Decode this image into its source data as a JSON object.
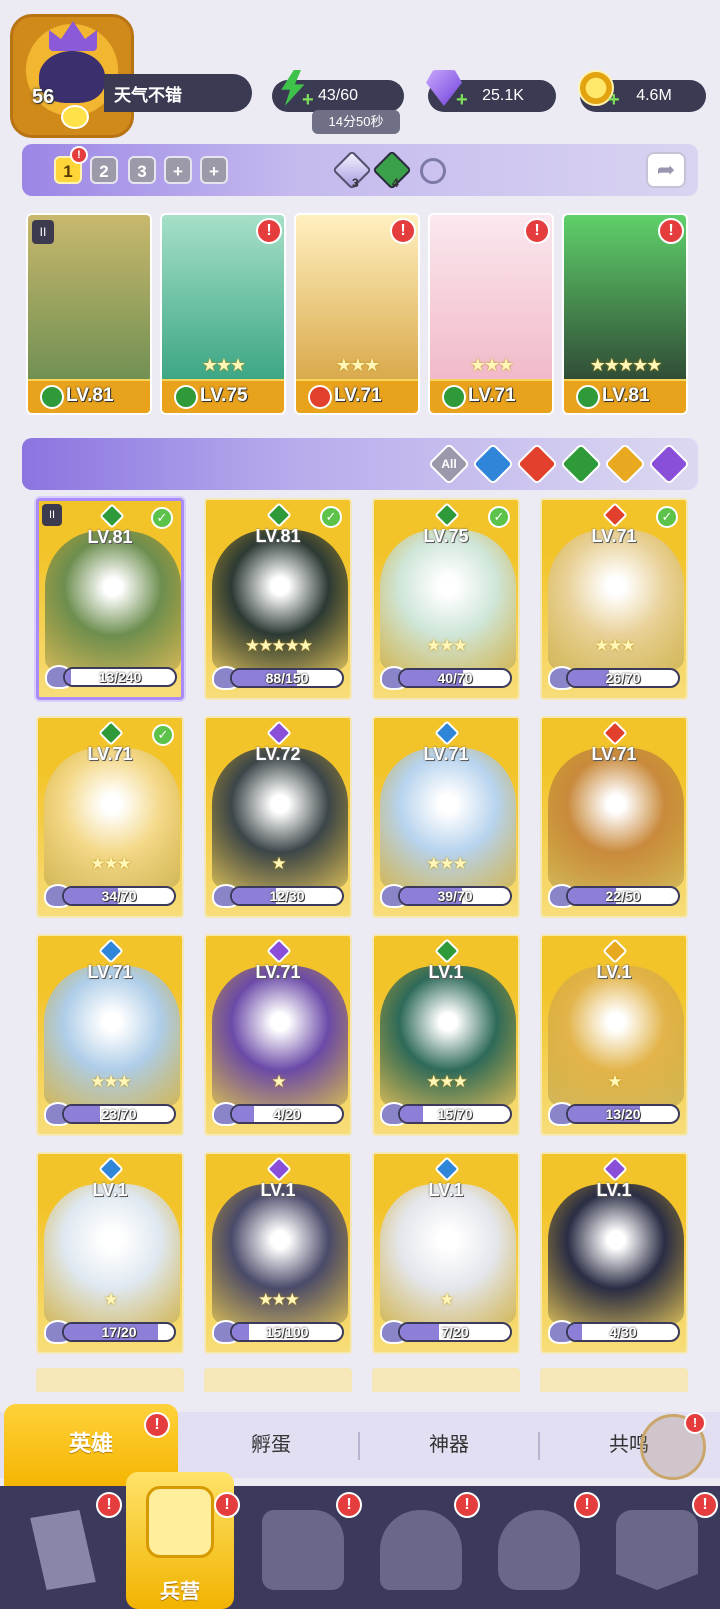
{
  "player": {
    "level": "56",
    "name": "天气不错"
  },
  "resources": {
    "energy": "43/60",
    "energy_timer": "14分50秒",
    "gems": "25.1K",
    "gold": "4.6M"
  },
  "team_bar": {
    "slots": [
      "1",
      "2",
      "3",
      "+",
      "+"
    ],
    "item_counts": [
      "3",
      "4"
    ]
  },
  "team": [
    {
      "level": "LV.81",
      "element_color": "#2f9a3a",
      "art": [
        "#6f8f52",
        "#c9b86d"
      ],
      "stars": "",
      "alert": false
    },
    {
      "level": "LV.75",
      "element_color": "#2f9a3a",
      "art": [
        "#3aa583",
        "#a6e0c8"
      ],
      "stars": "★★★",
      "alert": true
    },
    {
      "level": "LV.71",
      "element_color": "#e0402c",
      "art": [
        "#d9a84a",
        "#fff0c0"
      ],
      "stars": "★★★",
      "alert": true
    },
    {
      "level": "LV.71",
      "element_color": "#2f9a3a",
      "art": [
        "#f1b8c8",
        "#fbe8ee"
      ],
      "stars": "★★★",
      "alert": true
    },
    {
      "level": "LV.81",
      "element_color": "#2f9a3a",
      "art": [
        "#2f4a35",
        "#5fd06a"
      ],
      "stars": "★★★★★",
      "alert": true
    }
  ],
  "filters": [
    {
      "label": "All",
      "color": "#9a98aa"
    },
    {
      "label": "",
      "color": "#2f86d8"
    },
    {
      "label": "",
      "color": "#e0402c"
    },
    {
      "label": "",
      "color": "#2f9a3a"
    },
    {
      "label": "",
      "color": "#e8a920"
    },
    {
      "label": "",
      "color": "#8a4fd8"
    }
  ],
  "heroes": [
    {
      "level": "LV.81",
      "progress": "13/240",
      "ratio": 0.054,
      "elem": "#2f9a3a",
      "check": true,
      "stars": "",
      "art": "#6d8e4f"
    },
    {
      "level": "LV.81",
      "progress": "88/150",
      "ratio": 0.587,
      "elem": "#2f9a3a",
      "check": true,
      "stars": "★★★★★",
      "art": "#2c3a34"
    },
    {
      "level": "LV.75",
      "progress": "40/70",
      "ratio": 0.571,
      "elem": "#2f9a3a",
      "check": true,
      "stars": "★★★",
      "art": "#cfe6d9"
    },
    {
      "level": "LV.71",
      "progress": "26/70",
      "ratio": 0.371,
      "elem": "#e0402c",
      "check": true,
      "stars": "★★★",
      "art": "#e9d29a"
    },
    {
      "level": "LV.71",
      "progress": "34/70",
      "ratio": 0.486,
      "elem": "#2f9a3a",
      "check": true,
      "stars": "★★★",
      "art": "#f4d98a"
    },
    {
      "level": "LV.72",
      "progress": "12/30",
      "ratio": 0.4,
      "elem": "#8a4fd8",
      "check": false,
      "stars": "★",
      "art": "#3c4649"
    },
    {
      "level": "LV.71",
      "progress": "39/70",
      "ratio": 0.557,
      "elem": "#2f86d8",
      "check": false,
      "stars": "★★★",
      "art": "#b7d3ee"
    },
    {
      "level": "LV.71",
      "progress": "22/50",
      "ratio": 0.44,
      "elem": "#e0402c",
      "check": false,
      "stars": "",
      "art": "#c98a3c"
    },
    {
      "level": "LV.71",
      "progress": "23/70",
      "ratio": 0.329,
      "elem": "#2f86d8",
      "check": false,
      "stars": "★★★",
      "art": "#aecde8"
    },
    {
      "level": "LV.71",
      "progress": "4/20",
      "ratio": 0.2,
      "elem": "#8a4fd8",
      "check": false,
      "stars": "★",
      "art": "#6b4aa8"
    },
    {
      "level": "LV.1",
      "progress": "15/70",
      "ratio": 0.214,
      "elem": "#2f9a3a",
      "check": false,
      "stars": "★★★",
      "art": "#2e6a5a"
    },
    {
      "level": "LV.1",
      "progress": "13/20",
      "ratio": 0.65,
      "elem": "#e8a920",
      "check": false,
      "stars": "★",
      "art": "#e2b44a"
    },
    {
      "level": "LV.1",
      "progress": "17/20",
      "ratio": 0.85,
      "elem": "#2f86d8",
      "check": false,
      "stars": "★",
      "art": "#dfe8f0"
    },
    {
      "level": "LV.1",
      "progress": "15/100",
      "ratio": 0.15,
      "elem": "#8a4fd8",
      "check": false,
      "stars": "★★★",
      "art": "#4a4a6a"
    },
    {
      "level": "LV.1",
      "progress": "7/20",
      "ratio": 0.35,
      "elem": "#2f86d8",
      "check": false,
      "stars": "★",
      "art": "#e4e6ec"
    },
    {
      "level": "LV.1",
      "progress": "4/30",
      "ratio": 0.133,
      "elem": "#8a4fd8",
      "check": false,
      "stars": "",
      "art": "#2a2d45"
    }
  ],
  "subtabs": {
    "heroes": "英雄",
    "hatch": "孵蛋",
    "artifacts": "神器",
    "resonance": "共鸣"
  },
  "nav": {
    "barracks": "兵营"
  }
}
